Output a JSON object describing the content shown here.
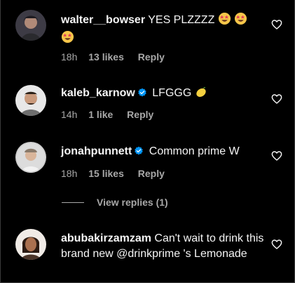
{
  "comments": [
    {
      "username": "walter__bowser",
      "verified": false,
      "text_before_emoji": "YES PLZZZZ",
      "emoji": [
        "star-struck-emoji",
        "star-struck-emoji",
        "star-struck-emoji"
      ],
      "time": "18h",
      "likes": "13 likes",
      "reply": "Reply"
    },
    {
      "username": "kaleb_karnow",
      "verified": true,
      "text": "LFGGG",
      "emoji": [
        "lemon-emoji"
      ],
      "time": "14h",
      "likes": "1 like",
      "reply": "Reply"
    },
    {
      "username": "jonahpunnett",
      "verified": true,
      "text": "Common prime W",
      "time": "18h",
      "likes": "15 likes",
      "reply": "Reply"
    },
    {
      "username": "abubakirzamzam",
      "verified": false,
      "text": "Can't wait to drink this brand new @drinkprime 's Lemonade"
    }
  ],
  "view_replies": "View replies (1)",
  "colors": {
    "background": "#000000",
    "text": "#f5f5f5",
    "secondary": "#a8a8a8",
    "verified": "#0095f6"
  }
}
